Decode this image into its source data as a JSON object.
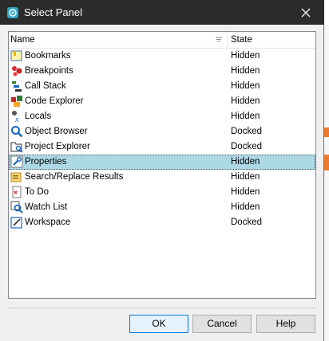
{
  "window": {
    "title": "Select Panel",
    "icon": "app-icon",
    "close_icon": "close-icon"
  },
  "list": {
    "columns": {
      "name": "Name",
      "state": "State"
    },
    "items": [
      {
        "name": "Bookmarks",
        "state": "Hidden",
        "icon": "bookmarks-icon"
      },
      {
        "name": "Breakpoints",
        "state": "Hidden",
        "icon": "breakpoints-icon"
      },
      {
        "name": "Call Stack",
        "state": "Hidden",
        "icon": "call-stack-icon"
      },
      {
        "name": "Code Explorer",
        "state": "Hidden",
        "icon": "code-explorer-icon"
      },
      {
        "name": "Locals",
        "state": "Hidden",
        "icon": "locals-icon"
      },
      {
        "name": "Object Browser",
        "state": "Docked",
        "icon": "object-browser-icon"
      },
      {
        "name": "Project Explorer",
        "state": "Docked",
        "icon": "project-explorer-icon"
      },
      {
        "name": "Properties",
        "state": "Hidden",
        "icon": "properties-icon",
        "selected": true
      },
      {
        "name": "Search/Replace Results",
        "state": "Hidden",
        "icon": "search-results-icon"
      },
      {
        "name": "To Do",
        "state": "Hidden",
        "icon": "todo-icon"
      },
      {
        "name": "Watch List",
        "state": "Hidden",
        "icon": "watch-list-icon"
      },
      {
        "name": "Workspace",
        "state": "Docked",
        "icon": "workspace-icon"
      }
    ]
  },
  "buttons": {
    "ok": "OK",
    "cancel": "Cancel",
    "help": "Help"
  },
  "colors": {
    "titlebar": "#2b2b2b",
    "selection": "#add8e6",
    "dialog_bg": "#f0f0f0"
  }
}
